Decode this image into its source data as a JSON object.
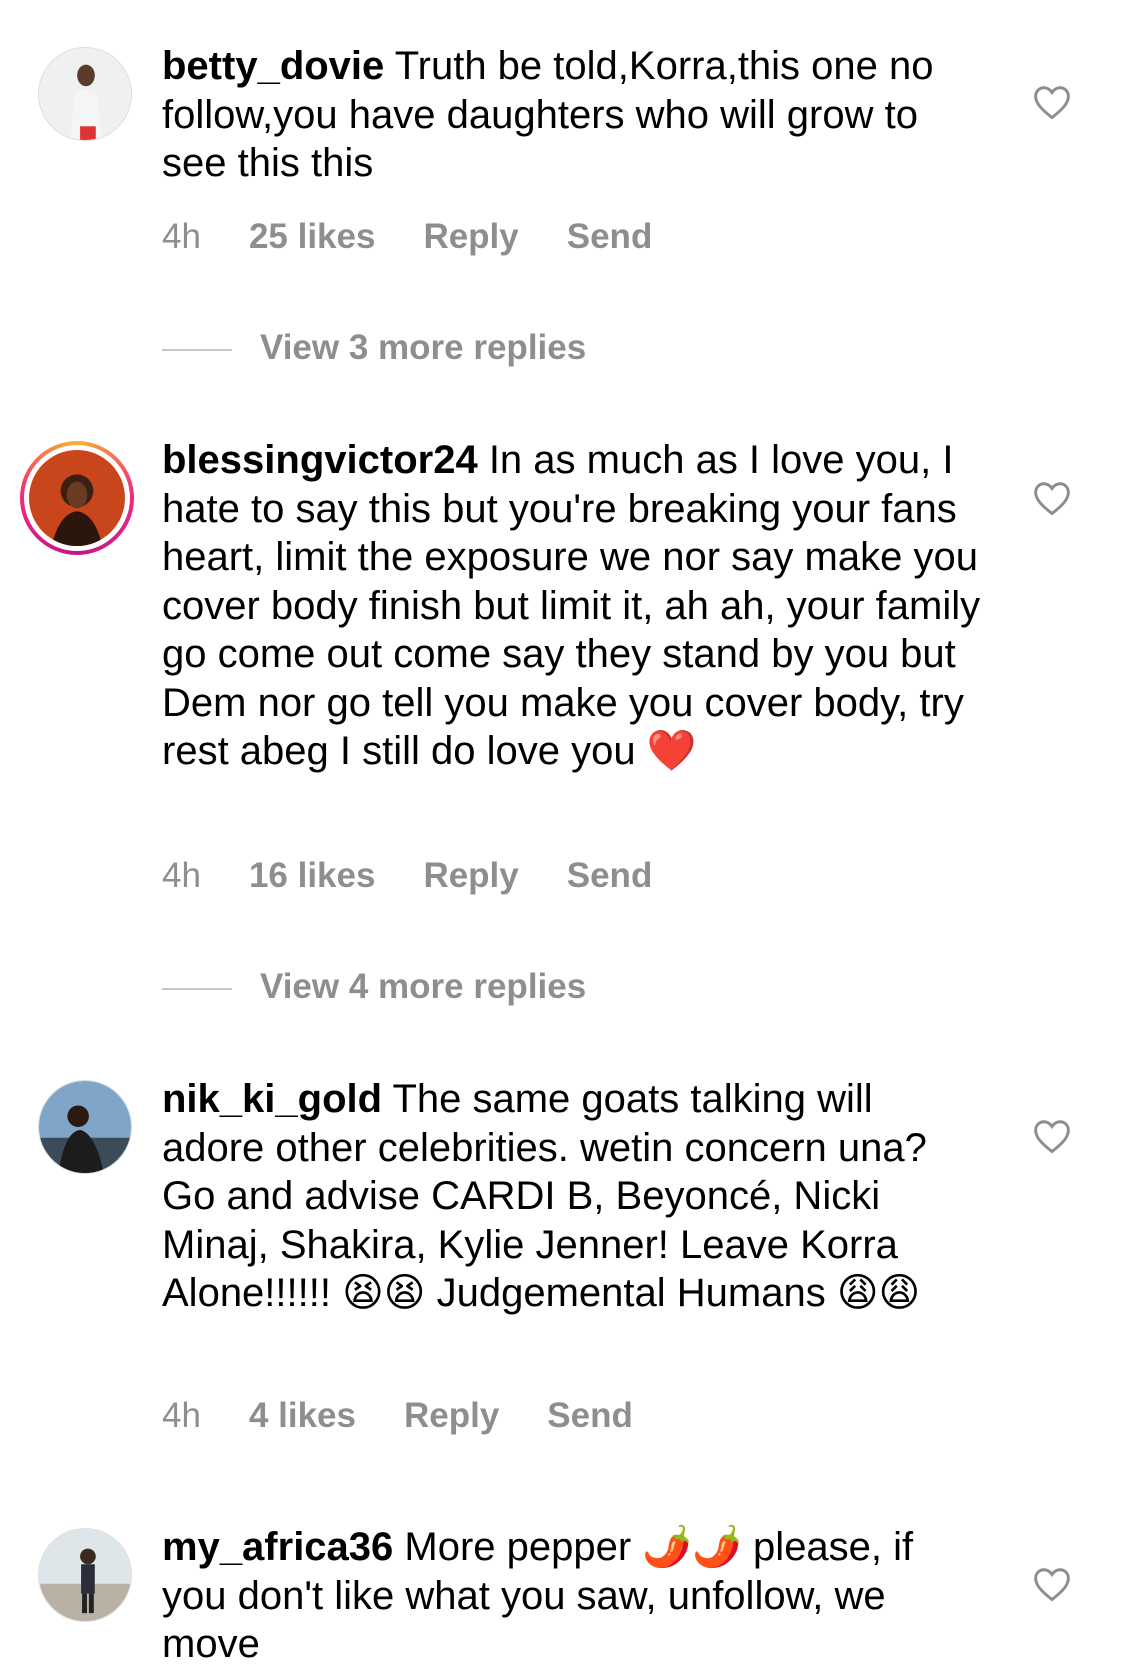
{
  "comments": [
    {
      "username": "betty_dovie",
      "text": "Truth be told,Korra,this one no follow,you have daughters who will grow to see this this",
      "time": "4h",
      "likes": "25 likes",
      "reply_label": "Reply",
      "send_label": "Send",
      "view_replies": "View 3 more replies"
    },
    {
      "username": "blessingvictor24",
      "text": "In as much as I love you, I hate to say this but you're breaking your fans heart, limit the exposure we nor say make you cover body finish but limit it, ah ah, your family go come out come say they stand by you but Dem nor go tell you make you cover body, try rest abeg I still do love you ❤️",
      "time": "4h",
      "likes": "16 likes",
      "reply_label": "Reply",
      "send_label": "Send",
      "view_replies": "View 4 more replies"
    },
    {
      "username": "nik_ki_gold",
      "text": "The same goats talking will adore other celebrities. wetin concern una? Go and advise CARDI B, Beyoncé, Nicki Minaj, Shakira, Kylie Jenner! Leave Korra Alone!!!!!! 😫😫 Judgemental Humans 😩😩",
      "time": "4h",
      "likes": "4 likes",
      "reply_label": "Reply",
      "send_label": "Send"
    },
    {
      "username": "my_africa36",
      "text": "More pepper 🌶️🌶️ please, if you don't like what you saw, unfollow, we move"
    }
  ],
  "icons": {
    "like": "heart-outline-icon"
  },
  "colors": {
    "meta": "#8e8e8e",
    "story_ring": "#ee2a7b"
  }
}
